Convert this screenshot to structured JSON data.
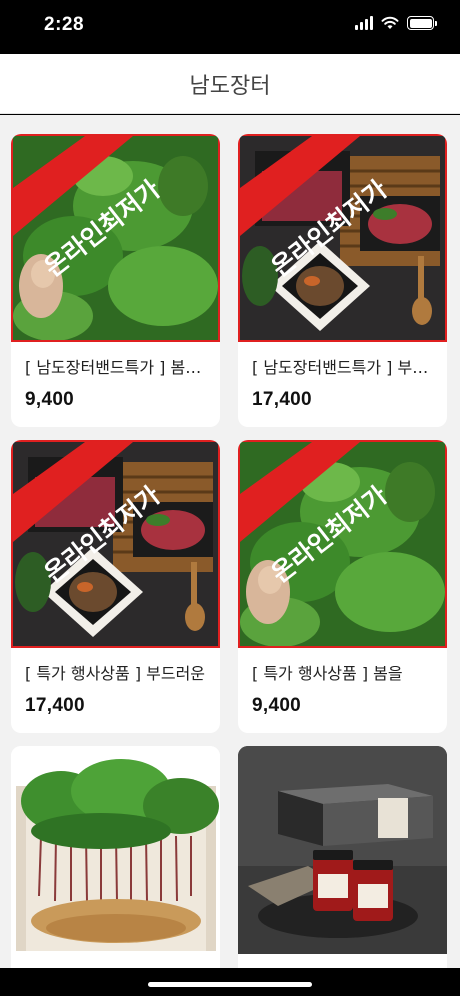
{
  "status": {
    "time": "2:28"
  },
  "nav": {
    "title": "남도장터"
  },
  "banner_text": "온라인최저가",
  "products": [
    {
      "title": "[ 남도장터밴드특가 ] 봄나물",
      "price": "9,400",
      "image": "greens-herb",
      "badge": true
    },
    {
      "title": "[ 남도장터밴드특가 ] 부드러운",
      "price": "17,400",
      "image": "beef-bulgogi",
      "badge": true
    },
    {
      "title": "[ 특가 행사상품 ] 부드러운",
      "price": "17,400",
      "image": "beef-bulgogi",
      "badge": true
    },
    {
      "title": "[ 특가 행사상품 ] 봄을",
      "price": "9,400",
      "image": "greens-herb",
      "badge": true
    },
    {
      "title": "",
      "price": "",
      "image": "ginseng-box",
      "badge": false
    },
    {
      "title": "",
      "price": "",
      "image": "sauce-jars",
      "badge": false
    }
  ]
}
